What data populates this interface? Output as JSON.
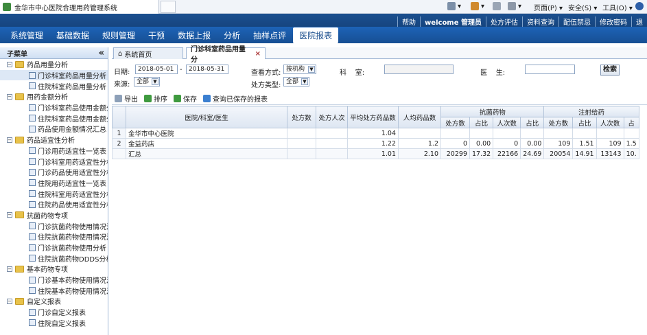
{
  "browser": {
    "tab_title": "金华市中心医院合理用药管理系统",
    "menu_page": "页面(P) ▾",
    "menu_safety": "安全(S) ▾",
    "menu_tools": "工具(O) ▾"
  },
  "topbar": {
    "help": "帮助",
    "welcome": "welcome 管理员",
    "links": [
      "处方评估",
      "资料查询",
      "配伍禁忌",
      "修改密码"
    ]
  },
  "nav": {
    "items": [
      "系统管理",
      "基础数据",
      "规则管理",
      "干预",
      "数据上报",
      "分析",
      "抽样点评",
      "医院报表"
    ],
    "active_index": 7
  },
  "sidebar": {
    "title": "子菜单",
    "collapse_glyph": "«",
    "groups": [
      {
        "label": "药品用量分析",
        "items": [
          "门诊科室药品用量分析",
          "住院科室药品用量分析"
        ]
      },
      {
        "label": "用药金额分析",
        "items": [
          "门诊科室药品使用金额分",
          "住院科室药品使用金额分",
          "药品使用金额情况汇总"
        ]
      },
      {
        "label": "药品适宜性分析",
        "items": [
          "门诊用药适宜性一览表",
          "门诊科室用药适宜性分析",
          "门诊药品使用适宜性分析",
          "住院用药适宜性一览表",
          "住院科室用药适宜性分析",
          "住院药品使用适宜性分析"
        ]
      },
      {
        "label": "抗菌药物专项",
        "items": [
          "门诊抗菌药物使用情况汇",
          "住院抗菌药物使用情况汇",
          "门诊抗菌药物使用分析",
          "住院抗菌药物DDDS分析"
        ]
      },
      {
        "label": "基本药物专项",
        "items": [
          "门诊基本药物使用情况汇",
          "住院基本药物使用情况汇"
        ]
      },
      {
        "label": "自定义报表",
        "items": [
          "门诊自定义报表",
          "住院自定义报表"
        ]
      }
    ]
  },
  "tabs": {
    "home": "系统首页",
    "current": "门诊科室药品用量分",
    "close_glyph": "×"
  },
  "filters": {
    "date_label": "日期:",
    "date_from": "2018-05-01",
    "date_sep": "-",
    "date_to": "2018-05-31",
    "view_label": "查看方式:",
    "view_value": "按机构",
    "dept_label": "科    室:",
    "doctor_label": "医    生:",
    "search_button": "检索",
    "source_label": "来源:",
    "source_value": "全部",
    "rx_type_label": "处方类型:",
    "rx_type_value": "全部"
  },
  "toolbar": {
    "export": "导出",
    "sort": "排序",
    "save": "保存",
    "query_saved": "查询已保存的报表"
  },
  "table": {
    "group_headers": {
      "antibacterial": "抗菌药物",
      "injection": "注射给药"
    },
    "headers": [
      "医院/科室/医生",
      "处方数",
      "处方人次",
      "平均处方药品数",
      "人均药品数"
    ],
    "sub_headers": [
      "处方数",
      "占比",
      "人次数",
      "占比",
      "处方数",
      "占比",
      "人次数",
      "占"
    ],
    "rows": [
      {
        "num": "1",
        "name": "金华市中心医院",
        "cells": [
          "",
          "",
          "1.04",
          "",
          "",
          "",
          "",
          "",
          "",
          "",
          "",
          ""
        ]
      },
      {
        "num": "2",
        "name": "金益药店",
        "cells": [
          "",
          "",
          "1.22",
          "1.2",
          "0",
          "0.00",
          "0",
          "0.00",
          "109",
          "1.51",
          "109",
          "1.5"
        ]
      },
      {
        "num": "",
        "name": "汇总",
        "cells": [
          "",
          "",
          "1.01",
          "2.10",
          "20299",
          "17.32",
          "22166",
          "24.69",
          "20054",
          "14.91",
          "13143",
          "10."
        ]
      }
    ]
  },
  "colors": {
    "nav_bg": "#1d63b7",
    "strip_bg": "#1b4f8f",
    "accent": "#184c8c"
  }
}
